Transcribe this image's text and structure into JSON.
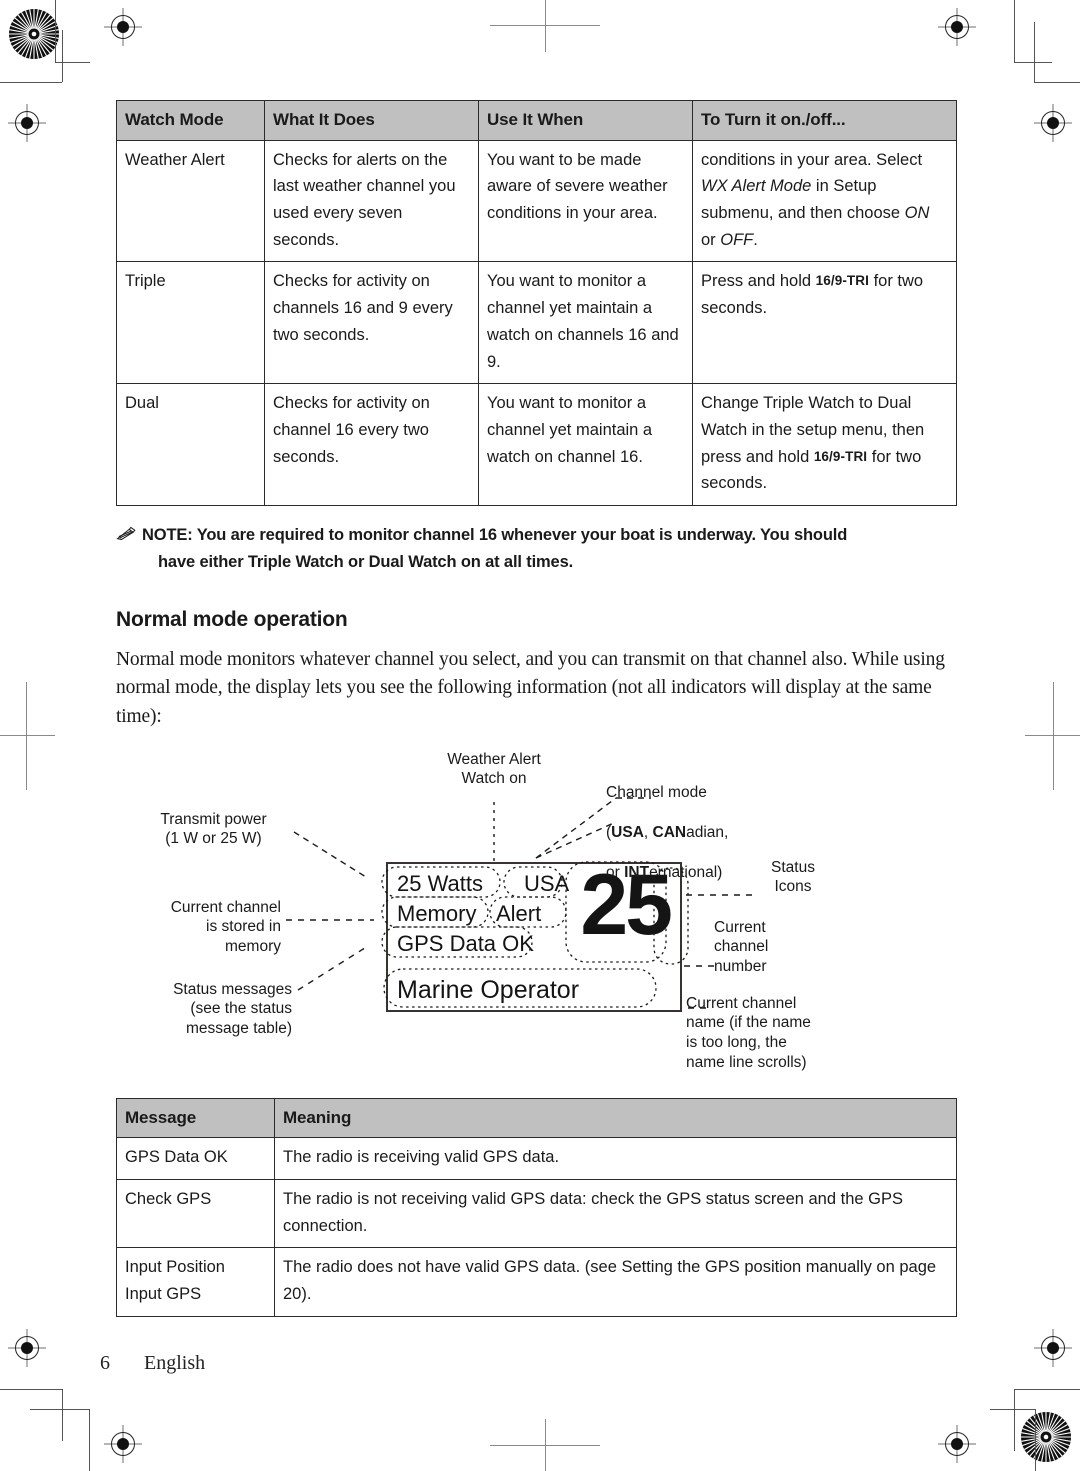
{
  "watch_table": {
    "headers": [
      "Watch Mode",
      "What It Does",
      "Use It When",
      "To Turn it on./off..."
    ],
    "rows": [
      {
        "mode": "Weather Alert",
        "what": "Checks for alerts on the last weather channel you used every seven seconds.",
        "when": "You want to be made aware of severe weather conditions in your area.",
        "how_pre": "conditions in your area. Select ",
        "how_it1": "WX Alert Mode",
        "how_mid": " in Setup submenu, and then choose ",
        "how_it2": "ON",
        "how_mid2": " or ",
        "how_it3": "OFF",
        "how_end": "."
      },
      {
        "mode": "Triple",
        "what": "Checks for activity on channels 16 and 9 every two seconds.",
        "when": "You want to monitor a channel yet maintain a watch on channels 16 and 9.",
        "how_pre": "Press and hold ",
        "how_key": "16/9-TRI",
        "how_end": " for two seconds."
      },
      {
        "mode": "Dual",
        "what": "Checks for activity on channel 16 every two seconds.",
        "when": "You want to monitor a channel yet maintain a watch on channel 16.",
        "how_pre": "Change Triple Watch to Dual Watch in the setup menu, then press and hold ",
        "how_key": "16/9-TRI",
        "how_end": " for two seconds."
      }
    ]
  },
  "note": {
    "icon": "pencil-icon",
    "line1": "NOTE: You are required to monitor channel 16 whenever your boat is underway. You should",
    "line2": "have either Triple Watch or Dual Watch on at all times."
  },
  "section": {
    "heading": "Normal mode operation",
    "paragraph": "Normal mode monitors whatever channel you select, and you can transmit on that channel also. While using normal mode, the display lets you see the following information (not all indicators will display at the same time):"
  },
  "diagram": {
    "lcd": {
      "watts": "25 Watts",
      "region": "USA",
      "memory": "Memory",
      "alert": "Alert",
      "gps": "GPS Data OK",
      "channel_number": "25",
      "channel_name": "Marine Operator"
    },
    "callouts": {
      "weather_alert": "Weather Alert\nWatch on",
      "channel_mode_l1": "Channel mode",
      "channel_mode_b1": "USA",
      "channel_mode_t1": ", ",
      "channel_mode_b2": "CAN",
      "channel_mode_t2": "adian,",
      "channel_mode_b3": "INT",
      "channel_mode_t3": "ernational)",
      "channel_mode_paren": "(",
      "channel_mode_or": "or ",
      "transmit_power": "Transmit power\n(1 W or 25 W)",
      "current_channel_memory": "Current channel\nis stored in\nmemory",
      "status_messages": "Status messages\n(see the status\nmessage table)",
      "status_icons": "Status\nIcons",
      "current_channel_number": "Current\nchannel\nnumber",
      "current_channel_name": "Current channel\nname (if the name\nis too long, the\nname line scrolls)"
    }
  },
  "message_table": {
    "headers": [
      "Message",
      "Meaning"
    ],
    "rows": [
      {
        "message": "GPS Data OK",
        "meaning": "The radio is receiving valid GPS data."
      },
      {
        "message": "Check GPS",
        "meaning": "The radio is not receiving valid GPS data: check the GPS status screen and the GPS connection."
      },
      {
        "message": "Input Position\nInput GPS",
        "meaning": "The radio does not have valid GPS data. (see Setting the GPS position manually on page 20)."
      }
    ]
  },
  "footer": {
    "page_number": "6",
    "language": "English"
  },
  "colors": {
    "header_bg": "#c0c0c0",
    "border": "#2b2b2b",
    "text": "#1a1a1a",
    "mark": "#8a8a8a"
  }
}
